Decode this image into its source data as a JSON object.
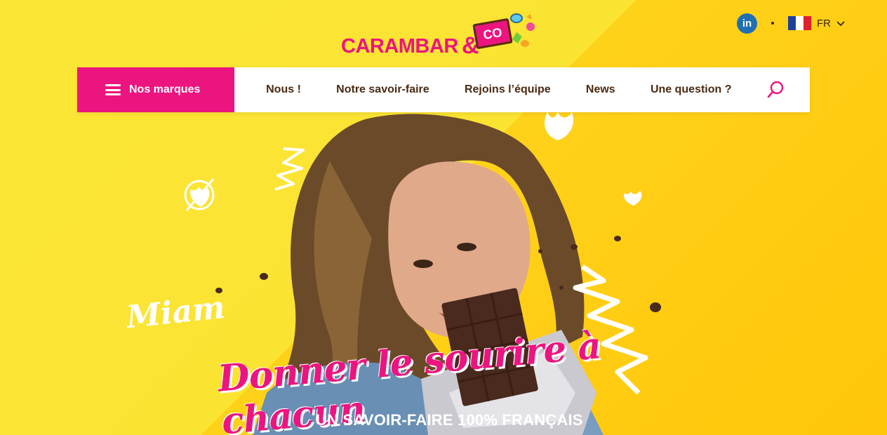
{
  "logo": {
    "brand": "CARAMBAR",
    "amp": "&",
    "co": "CO"
  },
  "social": {
    "linkedin_label": "in"
  },
  "language": {
    "selected": "FR",
    "flag_colors": [
      "#1f3f9e",
      "#ffffff",
      "#e0202a"
    ]
  },
  "nav": {
    "brands_label": "Nos marques",
    "links": [
      {
        "label": "Nous !"
      },
      {
        "label": "Notre savoir-faire"
      },
      {
        "label": "Rejoins l’équipe"
      },
      {
        "label": "News"
      },
      {
        "label": "Une question ?"
      }
    ]
  },
  "hero": {
    "miam": "Miam",
    "slogan": "Donner le sourire à chacun",
    "tagline": "UN SAVOIR-FAIRE 100% FRANÇAIS"
  },
  "colors": {
    "accent": "#ec1580",
    "text": "#4a2a12",
    "background": "#fbe332"
  }
}
